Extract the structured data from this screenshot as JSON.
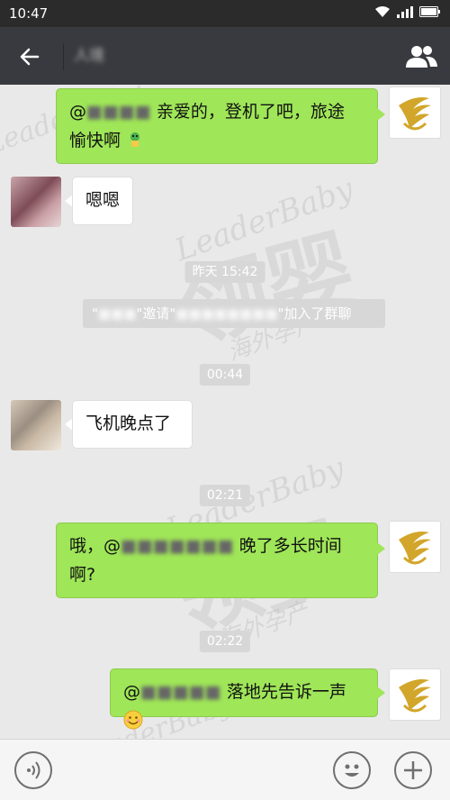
{
  "status_bar": {
    "time": "10:47"
  },
  "header": {
    "title": "人境"
  },
  "messages": {
    "m1_mention": "@",
    "m1_line1": "亲爱的，登机了吧，旅途",
    "m1_line2": "愉快啊",
    "m2_text": "嗯嗯",
    "t1": "昨天 15:42",
    "sys_left": "\"",
    "sys_invite": "\"邀请\"",
    "sys_right": "\"加入了群聊",
    "t2": "00:44",
    "m3_text": "飞机晚点了",
    "t3": "02:21",
    "m4_prefix": "哦，@",
    "m4_suffix": "晚了多长时间",
    "m4_line2": "啊?",
    "t4": "02:22",
    "m5_mention": "@",
    "m5_text": "落地先告诉一声"
  },
  "watermark": {
    "cn": "领婴",
    "brand": "LeaderBaby",
    "sub": "海外孕产"
  },
  "colors": {
    "header_bg": "#393a3f",
    "bubble_green": "#9fe658",
    "chat_bg": "#e9e9e9",
    "pill_bg": "#d7d7d7"
  },
  "icons": {
    "back": "arrow-left",
    "members": "people",
    "voice": "voice",
    "emoji": "smiley",
    "plus": "plus"
  }
}
